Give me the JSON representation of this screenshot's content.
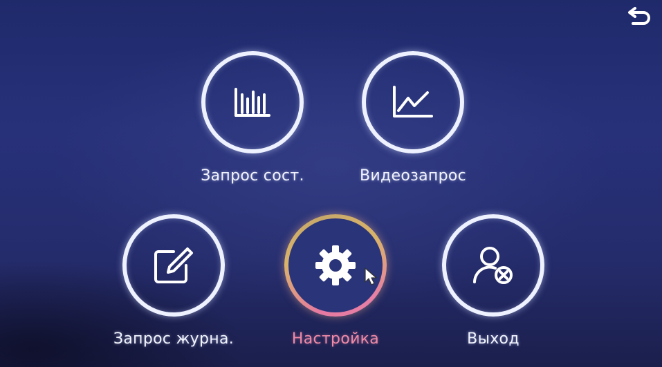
{
  "header": {
    "back_icon": "return-arrow-icon"
  },
  "menu": {
    "items": [
      {
        "label": "Запрос сост.",
        "icon": "bar-chart-icon",
        "active": false
      },
      {
        "label": "Видеозапрос",
        "icon": "line-chart-icon",
        "active": false
      },
      {
        "label": "Запрос журна.",
        "icon": "edit-note-icon",
        "active": false
      },
      {
        "label": "Настройка",
        "icon": "gear-icon",
        "active": true
      },
      {
        "label": "Выход",
        "icon": "user-remove-icon",
        "active": false
      }
    ]
  },
  "colors": {
    "ring": "#eef1ff",
    "active_label": "#f08aa8",
    "background": "#27317a"
  }
}
